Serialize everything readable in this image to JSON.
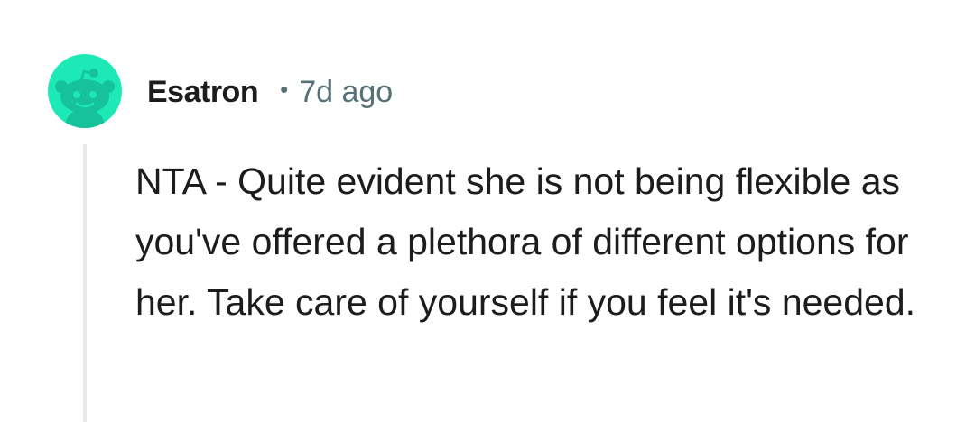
{
  "comment": {
    "username": "Esatron",
    "separator": "•",
    "timestamp": "7d ago",
    "body": "NTA - Quite evident she is not being flexible as you've offered a plethora of different options for her. Take care of yourself if you feel it's needed."
  },
  "avatar": {
    "icon": "reddit-snoo-icon",
    "background_color": "#1de9b6"
  },
  "colors": {
    "text_primary": "#1c1c1c",
    "text_meta": "#576f76",
    "thread_line": "#e8e8e8"
  }
}
